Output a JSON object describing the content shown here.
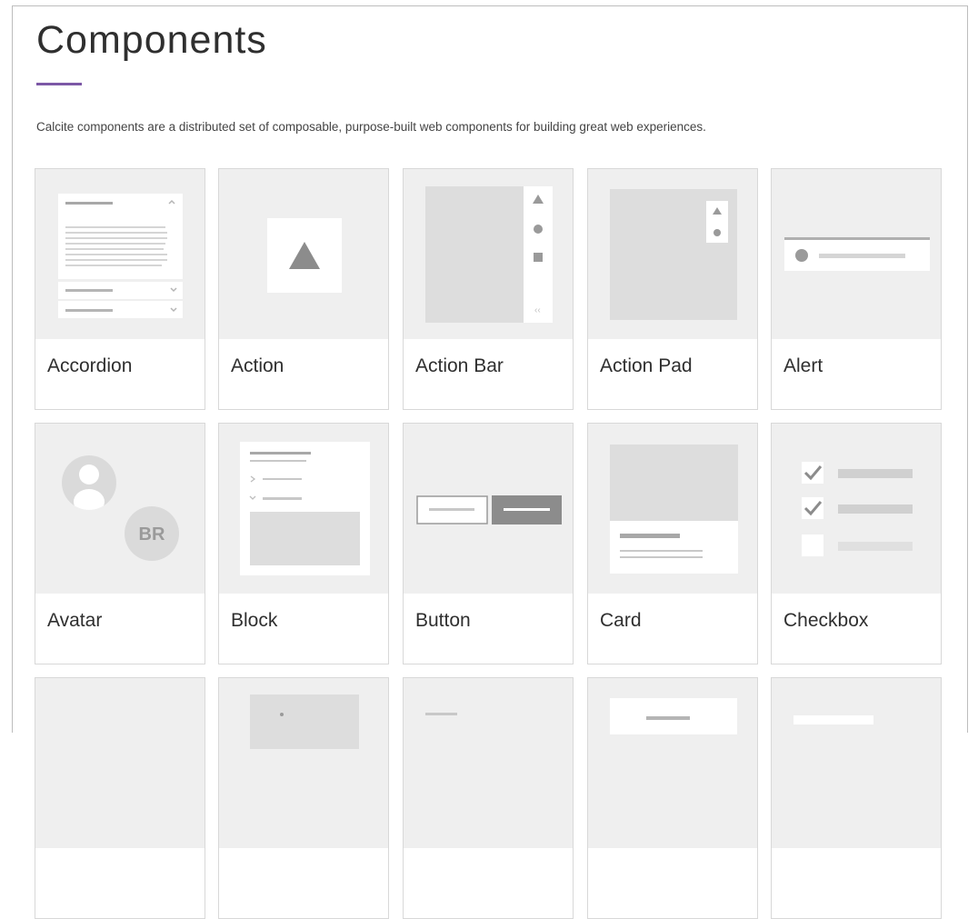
{
  "page": {
    "title": "Components",
    "description": "Calcite components are a distributed set of composable, purpose-built web components for building great web experiences.",
    "accent_color": "#7c58a6"
  },
  "components": [
    {
      "label": "Accordion",
      "thumbnail": "accordion-illustration"
    },
    {
      "label": "Action",
      "thumbnail": "action-illustration"
    },
    {
      "label": "Action Bar",
      "thumbnail": "action-bar-illustration"
    },
    {
      "label": "Action Pad",
      "thumbnail": "action-pad-illustration"
    },
    {
      "label": "Alert",
      "thumbnail": "alert-illustration"
    },
    {
      "label": "Avatar",
      "thumbnail": "avatar-illustration",
      "avatar_initials": "BR"
    },
    {
      "label": "Block",
      "thumbnail": "block-illustration"
    },
    {
      "label": "Button",
      "thumbnail": "button-illustration"
    },
    {
      "label": "Card",
      "thumbnail": "card-illustration"
    },
    {
      "label": "Checkbox",
      "thumbnail": "checkbox-illustration"
    }
  ]
}
